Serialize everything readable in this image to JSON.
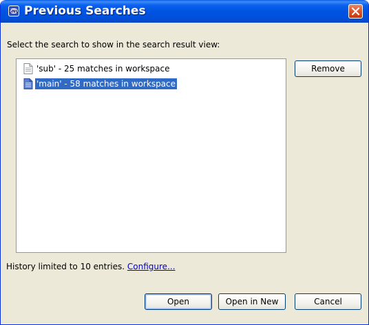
{
  "window": {
    "title": "Previous Searches",
    "app_icon": "gnu-app-icon",
    "close_icon": "close-icon"
  },
  "dialog": {
    "prompt": "Select the search to show in the search result view:",
    "list_items": [
      {
        "label": "'sub' - 25 matches in workspace",
        "selected": false,
        "icon": "document-icon"
      },
      {
        "label": "'main' - 58 matches in workspace",
        "selected": true,
        "icon": "document-icon"
      }
    ],
    "remove_label": "Remove",
    "history_text": "History limited to 10 entries.",
    "configure_link": "Configure...",
    "open_label": "Open",
    "open_new_label": "Open in New",
    "cancel_label": "Cancel"
  },
  "colors": {
    "titlebar": "#0053e1",
    "selection": "#316ac5",
    "dialog_bg": "#ece9d8",
    "link": "#0000cc"
  }
}
